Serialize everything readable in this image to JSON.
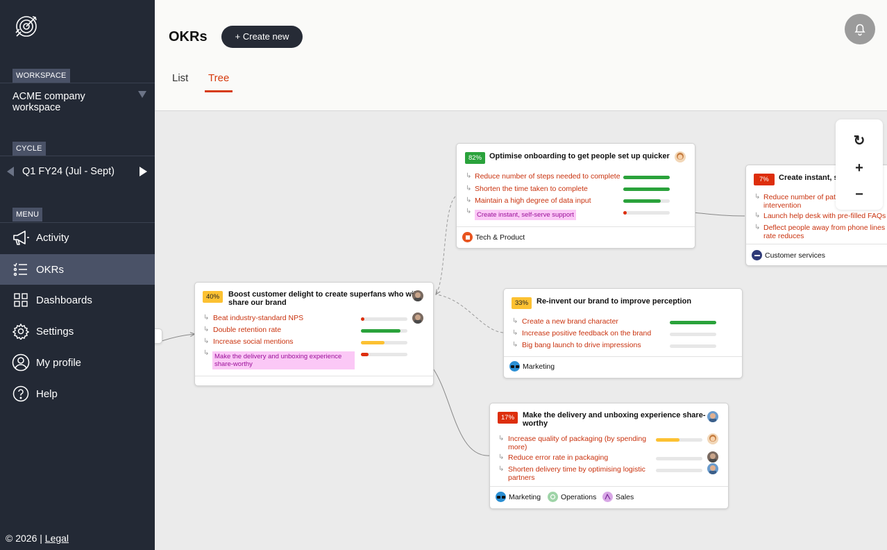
{
  "sidebar": {
    "logo_icon": "target-arrow-icon",
    "workspace_label": "WORKSPACE",
    "workspace_name": "ACME company workspace",
    "cycle_label": "CYCLE",
    "cycle_value": "Q1 FY24 (Jul - Sept)",
    "menu_label": "MENU",
    "menu": [
      {
        "label": "Activity",
        "icon": "megaphone-icon",
        "active": false
      },
      {
        "label": "OKRs",
        "icon": "list-icon",
        "active": true
      },
      {
        "label": "Dashboards",
        "icon": "grid-icon",
        "active": false
      },
      {
        "label": "Settings",
        "icon": "gear-icon",
        "active": false
      },
      {
        "label": "My profile",
        "icon": "user-icon",
        "active": false
      },
      {
        "label": "Help",
        "icon": "help-icon",
        "active": false
      }
    ],
    "footer_copyright": "© 2026 |",
    "footer_legal": "Legal"
  },
  "header": {
    "title": "OKRs",
    "create_label": "+ Create new",
    "tabs": [
      {
        "label": "List",
        "active": false
      },
      {
        "label": "Tree",
        "active": true
      }
    ],
    "bell_icon": "bell-icon"
  },
  "zoom": {
    "reset": "↻",
    "zoom_in": "+",
    "zoom_out": "−"
  },
  "colors": {
    "green": "#2aa23b",
    "yellow": "#fcc132",
    "red": "#dd2e0b",
    "accent": "#d63b0d",
    "sidebar": "#232935"
  },
  "cards": {
    "onboarding": {
      "percent": "82%",
      "title": "Optimise onboarding to get people set up quicker",
      "krs": [
        {
          "text": "Reduce number of steps needed to complete",
          "progress": 1.0
        },
        {
          "text": "Shorten the time taken to complete",
          "progress": 1.0
        },
        {
          "text": "Maintain a high degree of data input",
          "progress": 0.8
        },
        {
          "text": "Create instant, self-serve support",
          "progress": 0.07
        }
      ],
      "team": "Tech & Product"
    },
    "selfserve": {
      "percent": "7%",
      "title": "Create instant, se",
      "krs": [
        {
          "text_line1": "Reduce number of path",
          "text_line2": "intervention"
        },
        {
          "text": "Launch help desk with pre-filled FAQs"
        },
        {
          "text_line1": "Deflect people away from phone lines s",
          "text_line2": "rate reduces"
        }
      ],
      "team": "Customer services"
    },
    "delight": {
      "percent": "40%",
      "title_line1": "Boost customer delight to create superfans who will",
      "title_line2": "share our brand",
      "krs": [
        {
          "text": "Beat industry-standard NPS",
          "progress": 0.08
        },
        {
          "text": "Double retention rate",
          "progress": 0.85
        },
        {
          "text": "Increase social mentions",
          "progress": 0.5
        },
        {
          "text_line1": "Make the delivery and unboxing experience",
          "text_line2": "share-worthy",
          "progress": 0.17
        }
      ]
    },
    "brand": {
      "percent": "33%",
      "title": "Re-invent our brand to improve perception",
      "krs": [
        {
          "text": "Create a new brand character",
          "progress": 1.0
        },
        {
          "text": "Increase positive feedback on the brand",
          "progress": 0
        },
        {
          "text": "Big bang launch to drive impressions",
          "progress": 0
        }
      ],
      "team": "Marketing"
    },
    "delivery": {
      "percent": "17%",
      "title_line1": "Make the delivery and unboxing experience share-",
      "title_line2": "worthy",
      "krs": [
        {
          "text_line1": "Increase quality of packaging (by spending",
          "text_line2": "more)",
          "progress": 0.5
        },
        {
          "text": "Reduce error rate in packaging",
          "progress": 0
        },
        {
          "text_line1": "Shorten delivery time by optimising logistic",
          "text_line2": "partners",
          "progress": 0
        }
      ],
      "teams": [
        "Marketing",
        "Operations",
        "Sales"
      ]
    }
  }
}
